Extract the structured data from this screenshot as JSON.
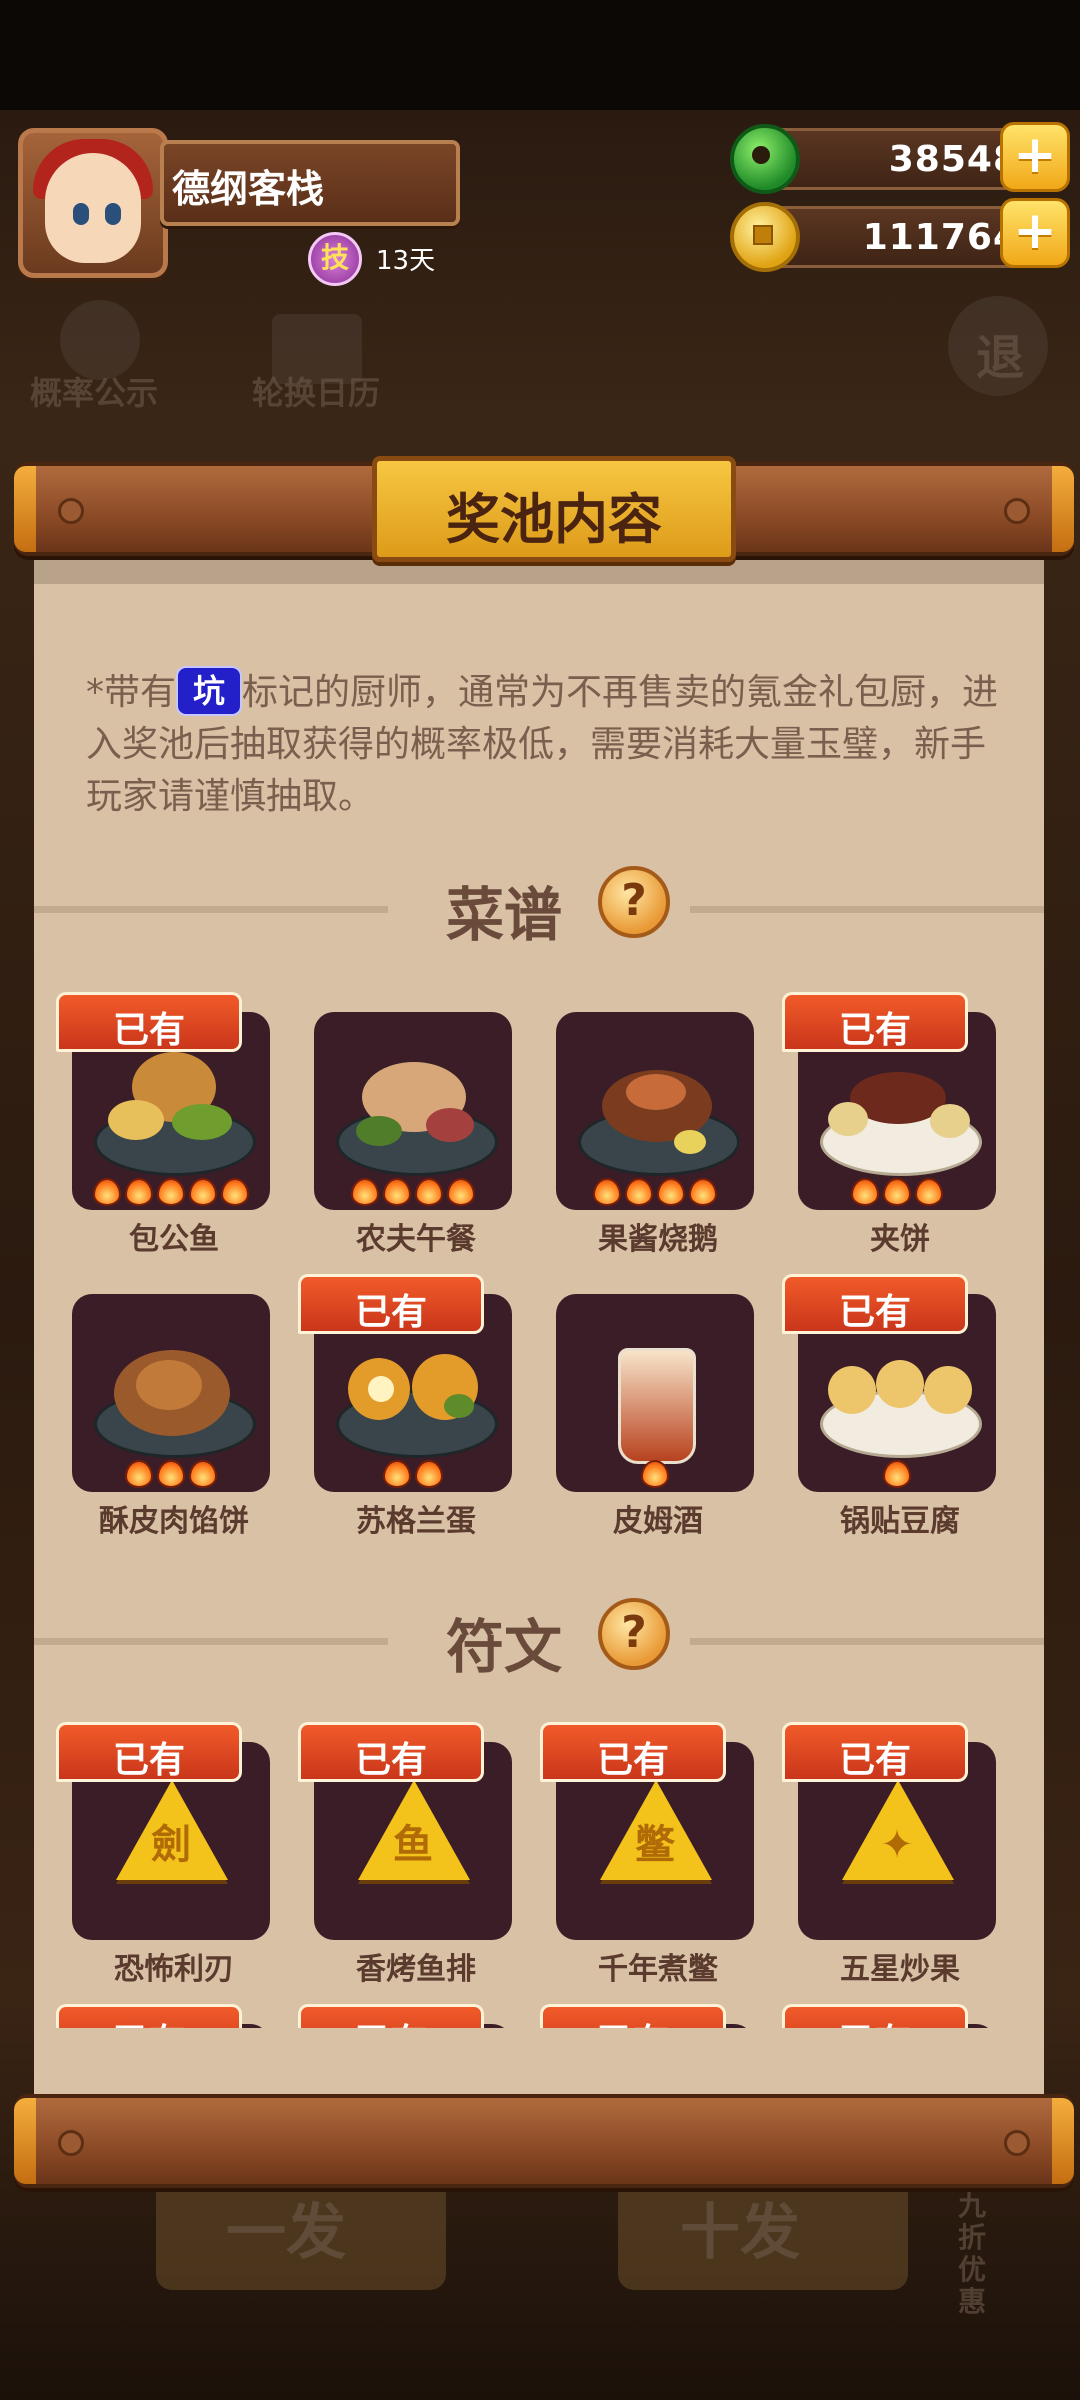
{
  "player": {
    "name": "德纲客栈",
    "skill_badge": "技",
    "skill_days": "13天",
    "jade": "38548",
    "coins": "111764",
    "plus": "+"
  },
  "background": {
    "probability_label": "概率公示",
    "probability_icon": "%",
    "calendar_label": "轮换日历",
    "calendar_icon": "12",
    "exit_label": "退",
    "partial_banner": "5",
    "single_draw": "一发",
    "ten_draw": "十发",
    "discount": "九折优惠"
  },
  "panel": {
    "title": "奖池内容",
    "notice_before": "*带有",
    "keng_tag": "坑",
    "notice_after": "标记的厨师，通常为不再售卖的氪金礼包厨，进入奖池后抽取获得的概率极低，需要消耗大量玉璧，新手玩家请谨慎抽取。",
    "owned_label": "已有",
    "help_symbol": "?"
  },
  "recipes": {
    "title": "菜谱",
    "items": [
      {
        "name": "包公鱼",
        "owned": true,
        "stars": 5
      },
      {
        "name": "农夫午餐",
        "owned": false,
        "stars": 4
      },
      {
        "name": "果酱烧鹅",
        "owned": false,
        "stars": 4
      },
      {
        "name": "夹饼",
        "owned": true,
        "stars": 3
      },
      {
        "name": "酥皮肉馅饼",
        "owned": false,
        "stars": 3
      },
      {
        "name": "苏格兰蛋",
        "owned": true,
        "stars": 2
      },
      {
        "name": "皮姆酒",
        "owned": false,
        "stars": 1
      },
      {
        "name": "锅贴豆腐",
        "owned": true,
        "stars": 1
      }
    ]
  },
  "runes": {
    "title": "符文",
    "items": [
      {
        "name": "恐怖利刃",
        "owned": true
      },
      {
        "name": "香烤鱼排",
        "owned": true
      },
      {
        "name": "千年煮鳖",
        "owned": true
      },
      {
        "name": "五星炒果",
        "owned": true
      },
      {
        "name": "",
        "owned": true
      },
      {
        "name": "",
        "owned": true
      },
      {
        "name": "",
        "owned": true
      },
      {
        "name": "",
        "owned": true
      }
    ]
  },
  "colors": {
    "paper": "#d9c1a6",
    "tile": "#3a1d26",
    "owned_badge": "#e2451f",
    "banner": "#f1b92e",
    "keng_tag": "#2320c9"
  }
}
